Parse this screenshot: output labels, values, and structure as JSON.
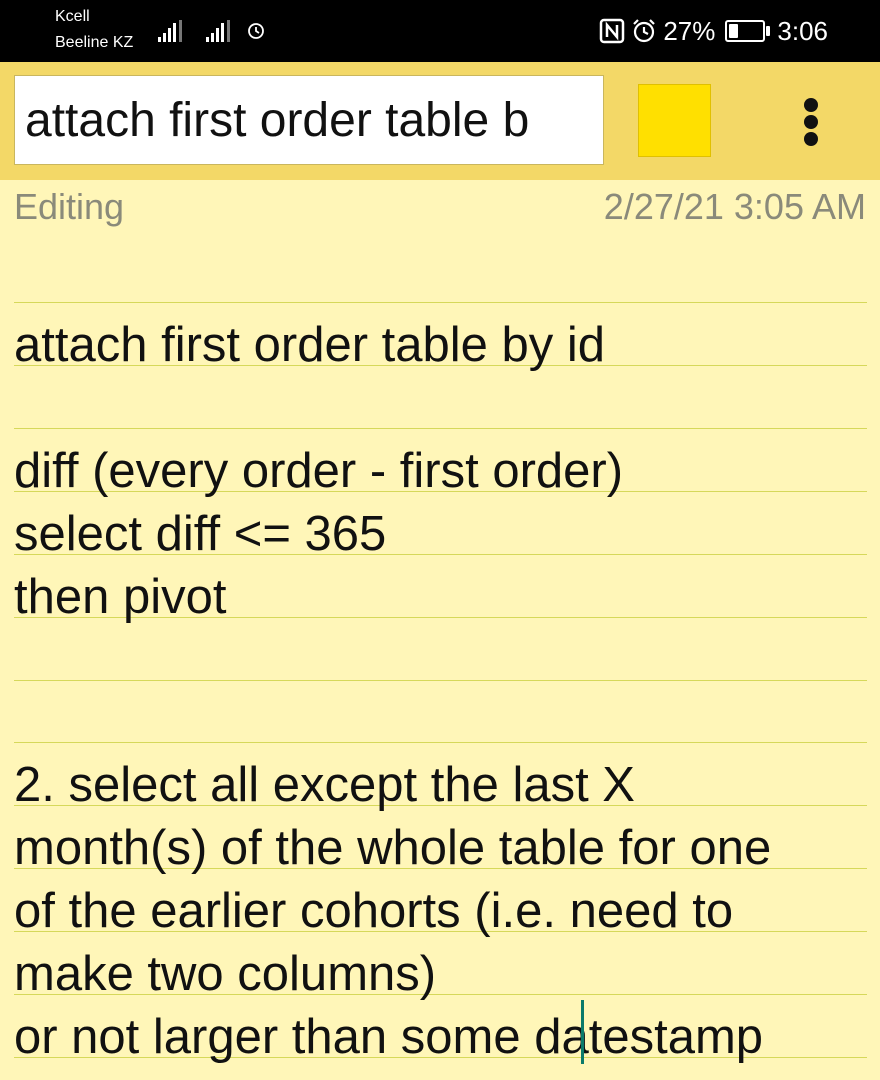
{
  "status_bar": {
    "carrier_1": "Kcell",
    "carrier_2": "Beeline KZ",
    "battery": "27%",
    "time": "3:06",
    "icons": [
      "signal-icon",
      "signal-icon",
      "alarm-icon",
      "nfc-icon",
      "alarm-icon",
      "battery-icon"
    ]
  },
  "toolbar": {
    "title_value": "attach first order table b",
    "swatch_color": "#ffe000",
    "menu_icon": "more-vert-icon"
  },
  "meta": {
    "status": "Editing",
    "date": "2/27/21 3:05 AM"
  },
  "note": {
    "lines": [
      "",
      "attach first order table by id",
      "",
      "diff (every order - first order)",
      "select diff <= 365",
      "then pivot",
      "",
      "",
      "2. select all except the last X",
      "month(s) of the whole table for one",
      "of the earlier cohorts (i.e. need to",
      "make two columns)",
      "or not larger than some datestamp"
    ]
  }
}
